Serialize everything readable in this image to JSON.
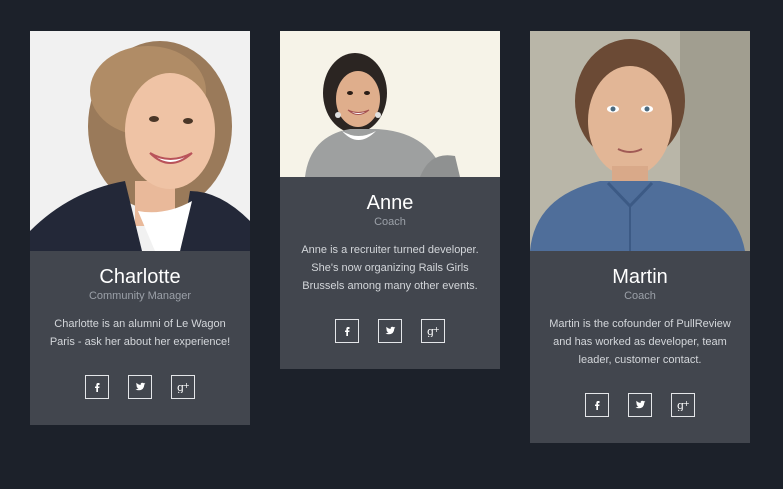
{
  "team": [
    {
      "name": "Charlotte",
      "role": "Community Manager",
      "bio": "Charlotte is an alumni of Le Wagon Paris - ask her about her experience!",
      "socials": [
        "facebook-icon",
        "twitter-icon",
        "google-plus-icon"
      ]
    },
    {
      "name": "Anne",
      "role": "Coach",
      "bio": "Anne is a recruiter turned developer. She's now organizing Rails Girls Brussels among many other events.",
      "socials": [
        "facebook-icon",
        "twitter-icon",
        "google-plus-icon"
      ]
    },
    {
      "name": "Martin",
      "role": "Coach",
      "bio": "Martin is the cofounder of PullReview and has worked as developer, team leader, customer contact.",
      "socials": [
        "facebook-icon",
        "twitter-icon",
        "google-plus-icon"
      ]
    }
  ],
  "colors": {
    "page_background": "#1c212a",
    "card_background": "#42464e",
    "name_text": "#ffffff",
    "role_text": "#9ba0a8",
    "bio_text": "#d3d6da",
    "social_border": "#e4e6e9"
  }
}
